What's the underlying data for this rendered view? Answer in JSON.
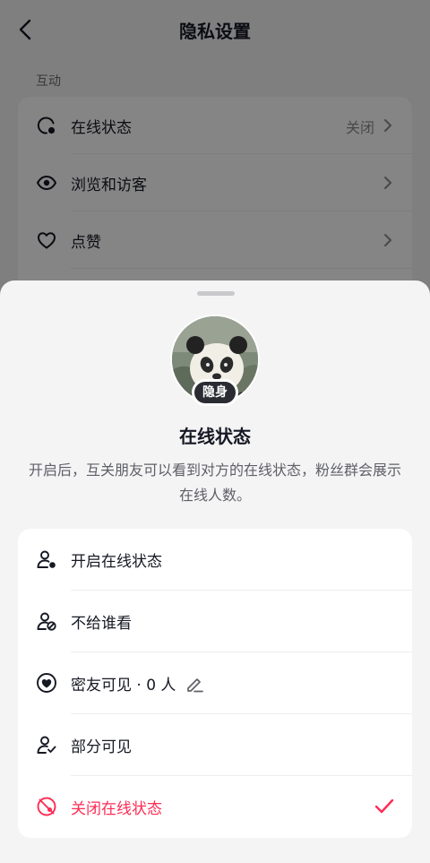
{
  "header": {
    "title": "隐私设置"
  },
  "section": {
    "label": "互动"
  },
  "settings_rows": [
    {
      "label": "在线状态",
      "value": "关闭",
      "icon": "online-status-icon"
    },
    {
      "label": "浏览和访客",
      "value": "",
      "icon": "eye-icon"
    },
    {
      "label": "点赞",
      "value": "",
      "icon": "heart-icon"
    }
  ],
  "sheet": {
    "avatar_badge": "隐身",
    "title": "在线状态",
    "description": "开启后，互关朋友可以看到对方的在线状态，粉丝群会展示在线人数。",
    "options": [
      {
        "label": "开启在线状态",
        "icon": "person-online-icon"
      },
      {
        "label": "不给谁看",
        "icon": "person-block-icon"
      },
      {
        "label": "密友可见 · 0 人",
        "icon": "heart-circle-icon"
      },
      {
        "label": "部分可见",
        "icon": "person-check-icon"
      },
      {
        "label": "关闭在线状态",
        "icon": "status-off-icon",
        "selected": true
      }
    ]
  },
  "colors": {
    "accent": "#fe2c55",
    "text": "#161823",
    "secondary": "#5f6066"
  }
}
